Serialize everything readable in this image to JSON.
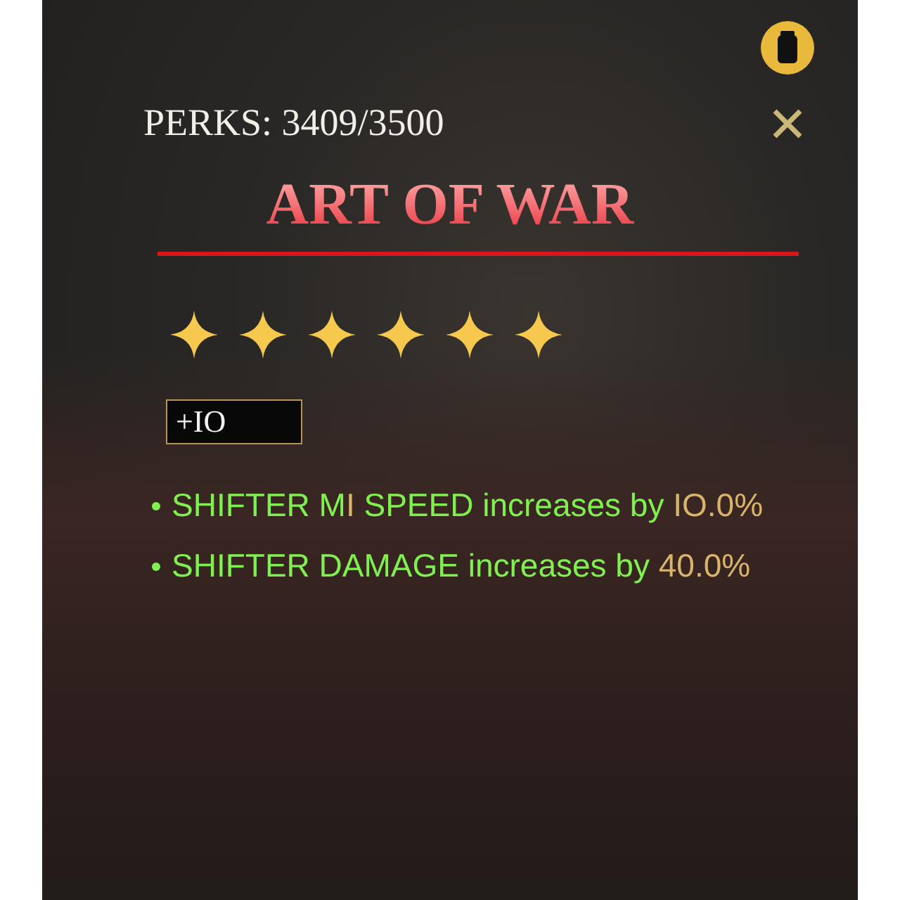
{
  "header": {
    "perks_label": "PERKS: 3409/3500"
  },
  "title": "ART OF WAR",
  "rating": {
    "stars": 6
  },
  "level_badge": "+IO",
  "effects": [
    {
      "parts": [
        {
          "text": "SHIFTER M",
          "highlight": false
        },
        {
          "text": "I",
          "highlight": true
        },
        {
          "text": " SPEED increases by ",
          "highlight": false
        },
        {
          "text": "IO.0%",
          "highlight": true
        }
      ]
    },
    {
      "parts": [
        {
          "text": "SHIFTER DAMAGE increases by ",
          "highlight": false
        },
        {
          "text": "40.0%",
          "highlight": true
        }
      ]
    }
  ]
}
